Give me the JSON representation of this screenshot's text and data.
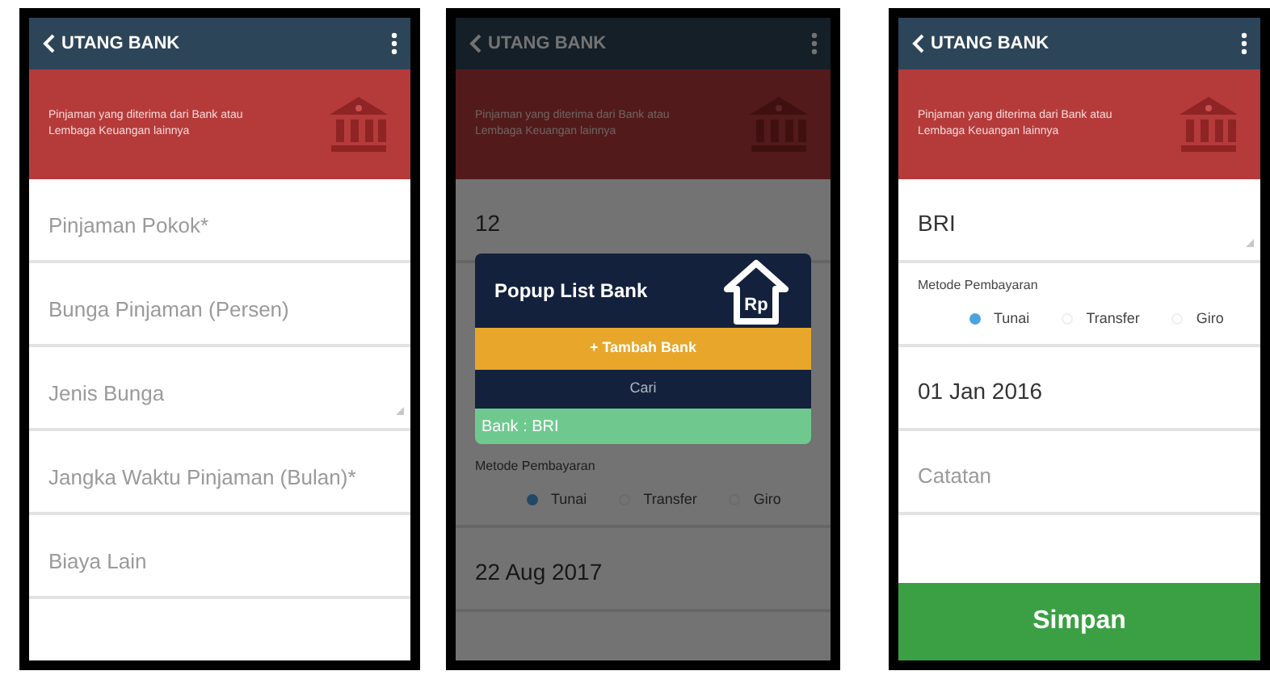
{
  "screens": [
    {
      "header": {
        "title": "UTANG BANK"
      },
      "banner": {
        "text": "Pinjaman yang diterima dari Bank atau Lembaga Keuangan lainnya"
      },
      "dimmed": false,
      "items": [
        {
          "kind": "input",
          "placeholder": "Pinjaman Pokok*"
        },
        {
          "kind": "input",
          "placeholder": "Bunga Pinjaman (Persen)"
        },
        {
          "kind": "select",
          "placeholder": "Jenis Bunga"
        },
        {
          "kind": "input",
          "placeholder": "Jangka Waktu Pinjaman (Bulan)*"
        },
        {
          "kind": "input",
          "placeholder": "Biaya Lain"
        }
      ]
    },
    {
      "header": {
        "title": "UTANG BANK"
      },
      "banner": {
        "text": "Pinjaman yang diterima dari Bank atau Lembaga Keuangan lainnya"
      },
      "dimmed": true,
      "items": [
        {
          "kind": "input",
          "value": "12"
        },
        {
          "kind": "radio_group",
          "label": "Metode Pembayaran",
          "options": [
            {
              "label": "Tunai",
              "selected": true
            },
            {
              "label": "Transfer",
              "selected": false
            },
            {
              "label": "Giro",
              "selected": false
            }
          ]
        },
        {
          "kind": "input",
          "value": "22 Aug 2017"
        }
      ],
      "popup": {
        "title": "Popup List Bank",
        "icon_text": "Rp",
        "add_button": "+ Tambah Bank",
        "search_placeholder": "Cari",
        "banks": [
          "Bank : BRI"
        ]
      }
    },
    {
      "header": {
        "title": "UTANG BANK"
      },
      "banner": {
        "text": "Pinjaman yang diterima dari Bank atau Lembaga Keuangan lainnya"
      },
      "dimmed": false,
      "items": [
        {
          "kind": "select",
          "value": "BRI"
        },
        {
          "kind": "radio_group",
          "label": "Metode Pembayaran",
          "options": [
            {
              "label": "Tunai",
              "selected": true
            },
            {
              "label": "Transfer",
              "selected": false
            },
            {
              "label": "Giro",
              "selected": false
            }
          ]
        },
        {
          "kind": "input",
          "value": "01 Jan 2016"
        },
        {
          "kind": "input",
          "placeholder": "Catatan"
        }
      ],
      "save_button": "Simpan"
    }
  ]
}
